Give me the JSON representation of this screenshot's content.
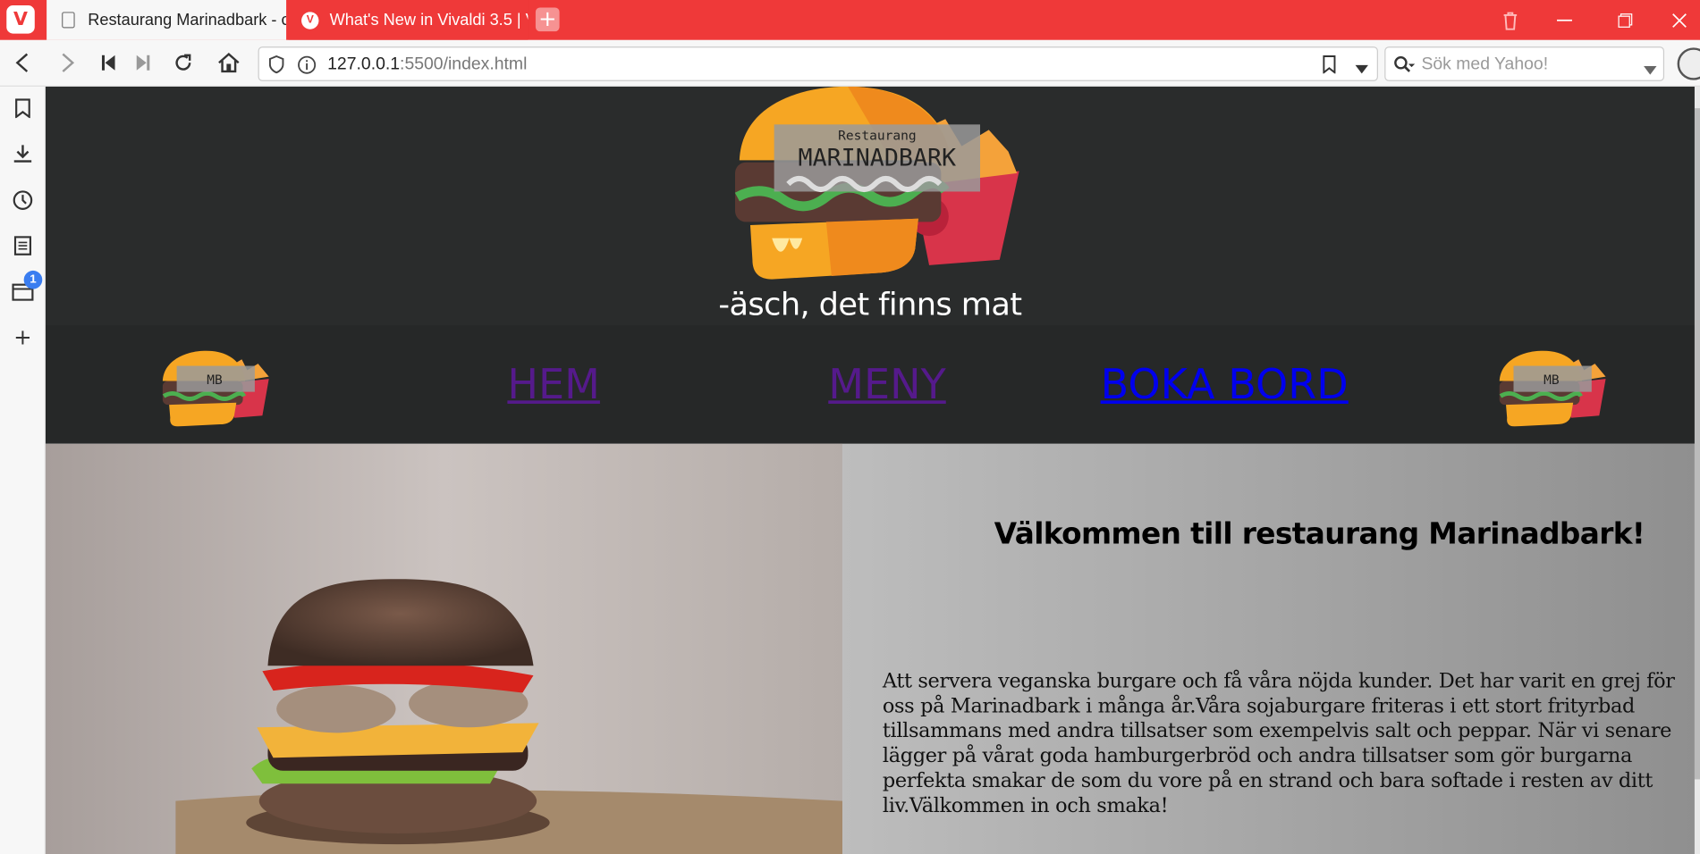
{
  "browser": {
    "tabs": [
      {
        "title": "Restaurang Marinadbark - c",
        "active": true
      },
      {
        "title": "What's New in Vivaldi 3.5 | V",
        "active": false
      }
    ],
    "url_host": "127.0.0.1",
    "url_rest": ":5500/index.html",
    "search_placeholder": "Sök med Yahoo!",
    "side_panel_badge": "1",
    "accent_color": "#ef3939"
  },
  "site": {
    "logo_text_small": "Restaurang",
    "logo_text_big": "MARINADBARK",
    "nav_logo_text": "MB",
    "tagline": "-äsch, det finns mat",
    "nav": [
      {
        "label": "HEM"
      },
      {
        "label": "MENY"
      },
      {
        "label": "BOKA BORD"
      }
    ],
    "welcome_heading": "Välkommen till restaurang Marinadbark!",
    "intro_paragraph": "Att servera veganska burgare och få våra nöjda kunder. Det har varit en grej för oss på Marinadbark i många år.Våra sojaburgare friteras i ett stort frityrbad tillsammans med andra tillsatser som exempelvis salt och peppar. När vi senare lägger på vårat goda hamburgerbröd och andra tillsatser som gör burgarna perfekta smakar de som du vore på en strand och bara softade i resten av ditt liv.Välkommen in och smaka!"
  }
}
